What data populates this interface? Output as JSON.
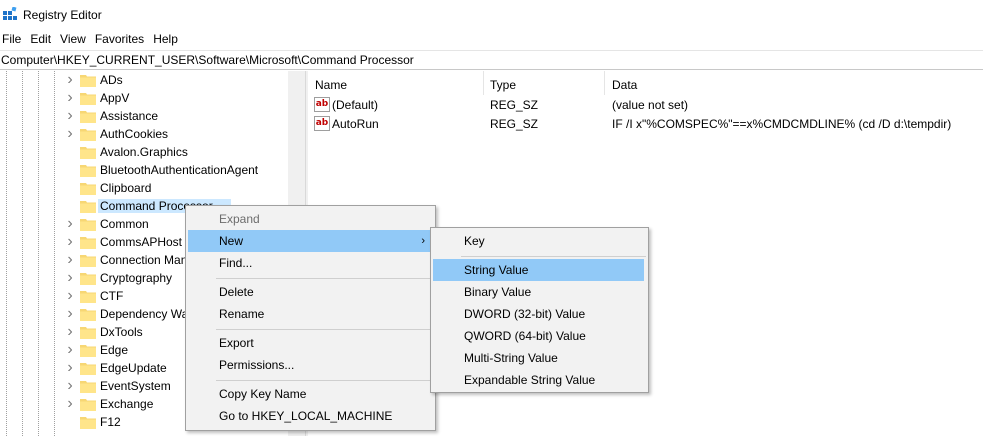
{
  "window": {
    "title": "Registry Editor"
  },
  "menu": [
    "File",
    "Edit",
    "View",
    "Favorites",
    "Help"
  ],
  "address": "Computer\\HKEY_CURRENT_USER\\Software\\Microsoft\\Command Processor",
  "tree": {
    "items": [
      {
        "label": "ADs",
        "expandable": true
      },
      {
        "label": "AppV",
        "expandable": true
      },
      {
        "label": "Assistance",
        "expandable": true
      },
      {
        "label": "AuthCookies",
        "expandable": true
      },
      {
        "label": "Avalon.Graphics",
        "expandable": false
      },
      {
        "label": "BluetoothAuthenticationAgent",
        "expandable": false
      },
      {
        "label": "Clipboard",
        "expandable": false
      },
      {
        "label": "Command Processor",
        "expandable": false,
        "selected": true
      },
      {
        "label": "Common",
        "expandable": true
      },
      {
        "label": "CommsAPHost",
        "expandable": true
      },
      {
        "label": "Connection Man",
        "expandable": true
      },
      {
        "label": "Cryptography",
        "expandable": true
      },
      {
        "label": "CTF",
        "expandable": true
      },
      {
        "label": "Dependency Wa",
        "expandable": true
      },
      {
        "label": "DxTools",
        "expandable": true
      },
      {
        "label": "Edge",
        "expandable": true
      },
      {
        "label": "EdgeUpdate",
        "expandable": true
      },
      {
        "label": "EventSystem",
        "expandable": true
      },
      {
        "label": "Exchange",
        "expandable": true
      },
      {
        "label": "F12",
        "expandable": false
      }
    ]
  },
  "columns": {
    "name": "Name",
    "type": "Type",
    "data": "Data"
  },
  "values": [
    {
      "name": "(Default)",
      "type": "REG_SZ",
      "data": "(value not set)"
    },
    {
      "name": "AutoRun",
      "type": "REG_SZ",
      "data": "IF /I x\"%COMSPEC%\"==x%CMDCMDLINE% (cd /D d:\\tempdir)"
    }
  ],
  "context_menu": {
    "items": [
      "Expand",
      "New",
      "Find...",
      "Delete",
      "Rename",
      "Export",
      "Permissions...",
      "Copy Key Name",
      "Go to HKEY_LOCAL_MACHINE"
    ],
    "disabled": "Expand",
    "highlighted": "New"
  },
  "submenu": {
    "items": [
      "Key",
      "String Value",
      "Binary Value",
      "DWORD (32-bit) Value",
      "QWORD (64-bit) Value",
      "Multi-String Value",
      "Expandable String Value"
    ],
    "highlighted": "String Value"
  },
  "colors": {
    "selection": "#cce8ff",
    "menu_highlight": "#91c9f7",
    "folder": "#f7d774"
  }
}
